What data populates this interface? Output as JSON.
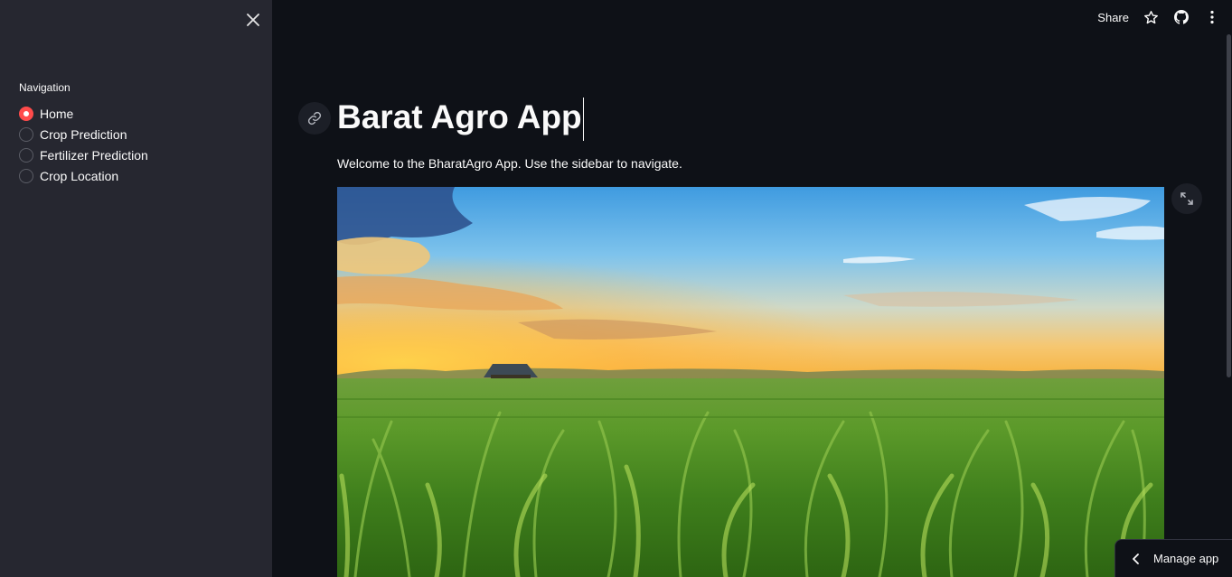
{
  "sidebar": {
    "navigation_label": "Navigation",
    "options": [
      {
        "label": "Home",
        "selected": true
      },
      {
        "label": "Crop Prediction",
        "selected": false
      },
      {
        "label": "Fertilizer Prediction",
        "selected": false
      },
      {
        "label": "Crop Location",
        "selected": false
      }
    ]
  },
  "header": {
    "share_label": "Share"
  },
  "main": {
    "title": "Barat Agro App",
    "welcome_text": "Welcome to the BharatAgro App. Use the sidebar to navigate."
  },
  "footer": {
    "manage_app_label": "Manage app"
  },
  "icons": [
    "close-icon",
    "star-icon",
    "github-icon",
    "more-vert-icon",
    "link-icon",
    "fullscreen-icon",
    "chevron-left-icon"
  ],
  "colors": {
    "accent": "#ff4b4b",
    "sidebar_bg": "#262730",
    "main_bg": "#0e1117"
  }
}
